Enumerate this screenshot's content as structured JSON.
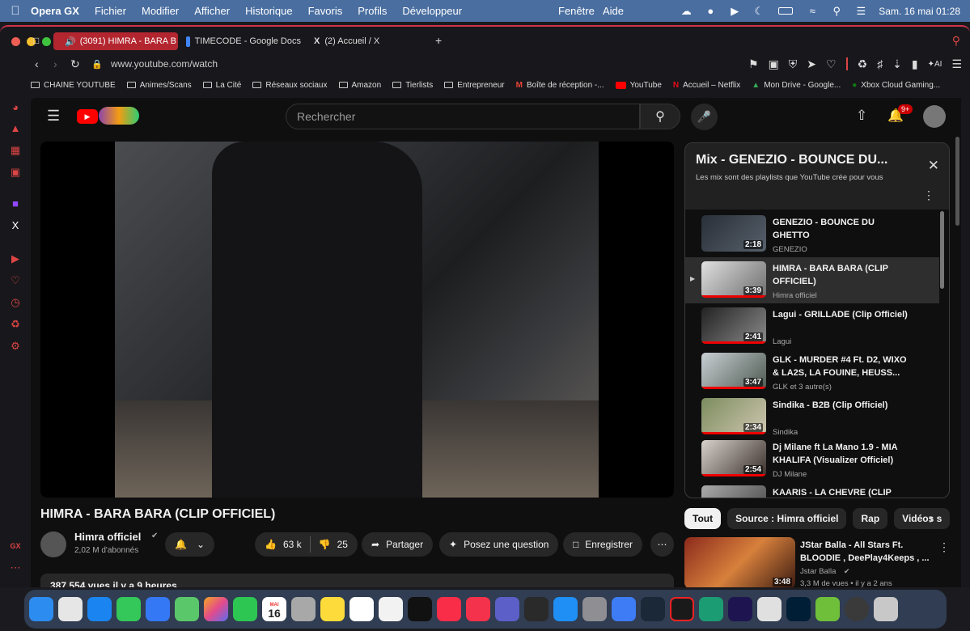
{
  "menubar": {
    "app": "Opera GX",
    "items": [
      "Fichier",
      "Modifier",
      "Afficher",
      "Historique",
      "Favoris",
      "Profils",
      "Développeur"
    ],
    "right_items": [
      "Fenêtre",
      "Aide"
    ],
    "datetime": "Sam. 16 mai 01:28"
  },
  "tabs": [
    {
      "label": "(3091) HIMRA - BARA B",
      "active": true
    },
    {
      "label": "TIMECODE - Google Docs",
      "active": false
    },
    {
      "label": "(2) Accueil / X",
      "active": false
    }
  ],
  "address": {
    "url": "www.youtube.com/watch"
  },
  "bookmarks": [
    "CHAINE YOUTUBE",
    "Animes/Scans",
    "La Cité",
    "Réseaux sociaux",
    "Amazon",
    "Tierlists",
    "Entrepreneur",
    "Boîte de réception -...",
    "YouTube",
    "Accueil – Netflix",
    "Mon Drive - Google...",
    "Xbox Cloud Gaming..."
  ],
  "sidebar_labels": {
    "gx": "GX"
  },
  "youtube": {
    "search_placeholder": "Rechercher",
    "notif_count": "9+",
    "video_title": "HIMRA - BARA BARA (CLIP OFFICIEL)",
    "channel": {
      "name": "Himra officiel",
      "subs": "2,02 M d'abonnés"
    },
    "actions": {
      "likes": "63 k",
      "dislikes": "25",
      "share": "Partager",
      "ask": "Posez une question",
      "save": "Enregistrer"
    },
    "stats": "387 554 vues  il y a 9 heures"
  },
  "mix": {
    "title": "Mix - GENEZIO - BOUNCE DU...",
    "subtitle": "Les mix sont des playlists que YouTube crée pour vous",
    "items": [
      {
        "title": "GENEZIO - BOUNCE DU GHETTO",
        "channel": "GENEZIO",
        "duration": "2:18"
      },
      {
        "title": "HIMRA - BARA BARA (CLIP OFFICIEL)",
        "channel": "Himra officiel",
        "duration": "3:39"
      },
      {
        "title": "Lagui - GRILLADE (Clip Officiel)",
        "channel": "Lagui",
        "duration": "2:41"
      },
      {
        "title": "GLK - MURDER #4 Ft. D2, WIXO & LA2S, LA FOUINE, HEUSS...",
        "channel": "GLK et 3 autre(s)",
        "duration": "3:47"
      },
      {
        "title": "Sindika - B2B (Clip Officiel)",
        "channel": "Sindika",
        "duration": "2:34"
      },
      {
        "title": "Dj Milane ft La Mano 1.9 - MIA KHALIFA (Visualizer Officiel)",
        "channel": "DJ Milane",
        "duration": "2:54"
      },
      {
        "title": "KAARIS - LA CHEVRE (CLIP",
        "channel": "",
        "duration": ""
      }
    ]
  },
  "chips": [
    "Tout",
    "Source : Himra officiel",
    "Rap",
    "Vidéos s"
  ],
  "recommendation": {
    "title": "JStar Balla - All Stars Ft. BLOODIE , DeePlay4Keeps , ...",
    "channel": "Jstar Balla",
    "meta": "3,3 M de vues • il y a 2 ans",
    "duration": "3:48"
  },
  "dock": {
    "calendar_month": "MAI",
    "calendar_day": "16"
  }
}
